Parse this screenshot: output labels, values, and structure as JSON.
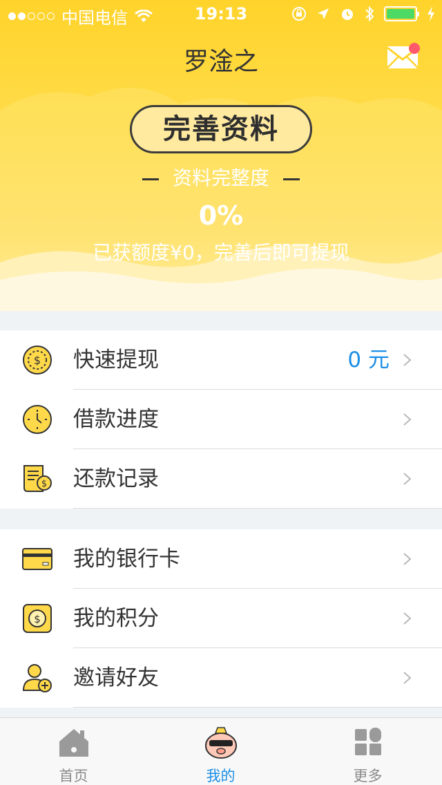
{
  "status_bar": {
    "carrier": "中国电信",
    "time": "19:13",
    "signal_dots_filled": 2,
    "signal_dots_total": 5,
    "battery_level": 1.0,
    "icons": [
      "wifi-icon",
      "rotation-lock-icon",
      "location-icon",
      "alarm-icon",
      "bluetooth-icon",
      "battery-icon",
      "charging-icon"
    ]
  },
  "nav": {
    "title": "罗淦之",
    "mail_icon": "mail-icon",
    "has_unread": true
  },
  "profile": {
    "complete_button": "完善资料",
    "completeness_label": "资料完整度",
    "percent": "0%",
    "quota_text": "已获额度¥0，完善后即可提现"
  },
  "menu_group_1": [
    {
      "label": "快速提现",
      "value": "0 元",
      "icon": "coin-icon"
    },
    {
      "label": "借款进度",
      "value": "",
      "icon": "clock-icon"
    },
    {
      "label": "还款记录",
      "value": "",
      "icon": "bill-icon"
    }
  ],
  "menu_group_2": [
    {
      "label": "我的银行卡",
      "value": "",
      "icon": "bank-card-icon"
    },
    {
      "label": "我的积分",
      "value": "",
      "icon": "points-icon"
    },
    {
      "label": "邀请好友",
      "value": "",
      "icon": "invite-friend-icon"
    }
  ],
  "tabbar": [
    {
      "label": "首页",
      "icon": "home-icon",
      "active": false
    },
    {
      "label": "我的",
      "icon": "pig-mascot-icon",
      "active": true
    },
    {
      "label": "更多",
      "icon": "grid-more-icon",
      "active": false
    }
  ],
  "colors": {
    "header_yellow": "#ffd32a",
    "accent_blue": "#1b8ee6",
    "icon_yellow": "#ffd94a",
    "badge_red": "#ff5a6b",
    "battery_green": "#4cd964"
  }
}
